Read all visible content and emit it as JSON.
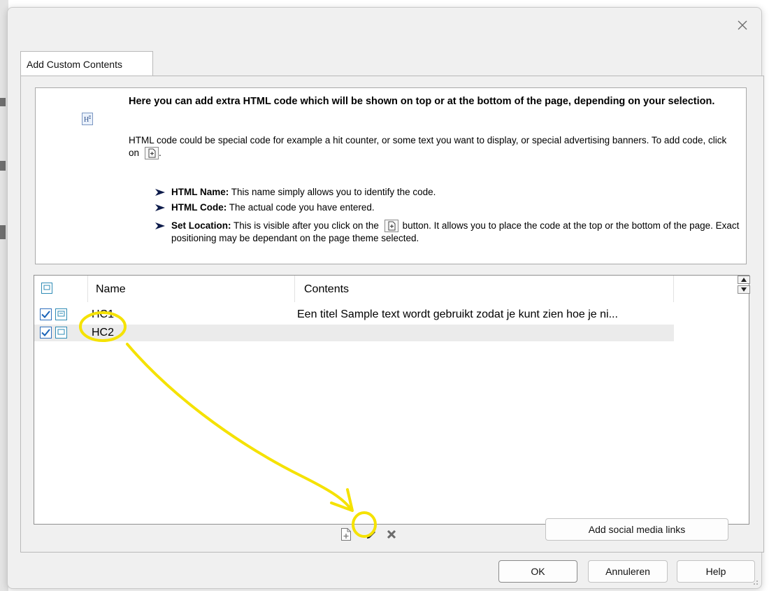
{
  "dialog": {
    "tab_label": "Add Custom Contents"
  },
  "intro": {
    "heading": "Here you can add extra HTML code which will be shown on top or at the bottom of the page, depending on your selection.",
    "body_before_icon": "HTML code could be special code for example a hit counter, or some text you want to display, or special advertising banners. To add code, click on",
    "body_after_icon": ".",
    "bullets": [
      {
        "term": "HTML Name:",
        "text": " This name simply allows you to identify the code."
      },
      {
        "term": "HTML Code:",
        "text": " The actual code you have entered."
      },
      {
        "term": "Set Location:",
        "text_before_icon": " This is visible after you click on the",
        "text_after_icon": " button. It allows you to place the code at the top or the bottom of the page. Exact positioning may be dependant on the page theme selected."
      }
    ]
  },
  "list": {
    "columns": {
      "name": "Name",
      "contents": "Contents"
    },
    "rows": [
      {
        "checked": true,
        "name": "HC1",
        "contents": "Een titel Sample text wordt gebruikt zodat je kunt zien hoe je ni...",
        "selected": false
      },
      {
        "checked": true,
        "name": "HC2",
        "contents": "",
        "selected": true
      }
    ]
  },
  "buttons": {
    "social": "Add social media links",
    "ok": "OK",
    "cancel": "Annuleren",
    "help": "Help"
  },
  "icons": {
    "close": "close-icon",
    "info": "html-page-icon",
    "new_code": "new-document-icon",
    "edit": "pencil-icon",
    "delete": "delete-x-icon"
  },
  "colors": {
    "annotation": "#f5e200",
    "checkbox_blue": "#2e6fbd",
    "bullet_navy": "#0d1b4a"
  }
}
